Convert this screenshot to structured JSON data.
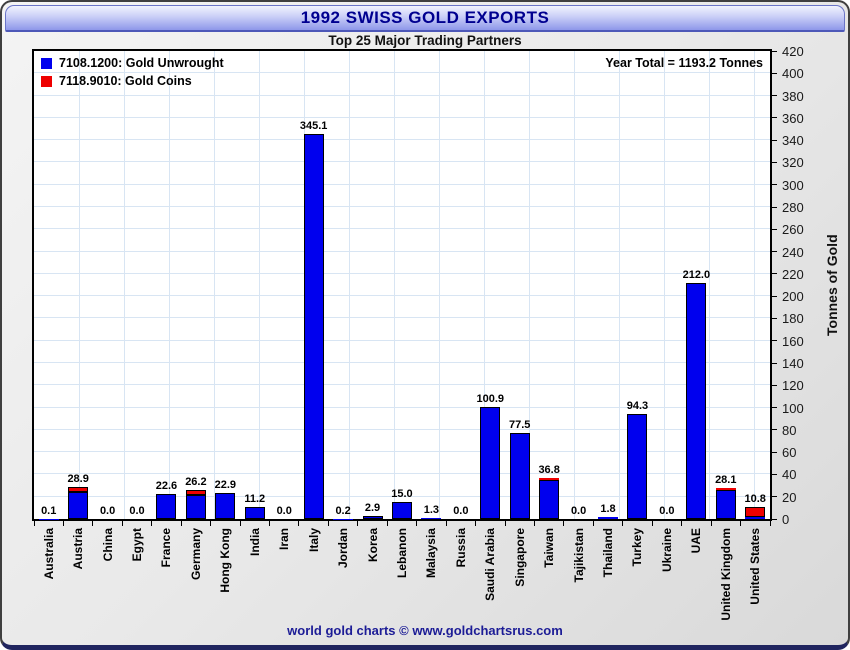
{
  "window": {
    "footer": "world gold charts © www.goldchartsrus.com"
  },
  "colors": {
    "unwrought_blue": "#0000ee",
    "coins_red": "#ee0000",
    "grid": "#d8e5f3",
    "title_navy": "#000090",
    "footer_navy": "#1c1c96"
  },
  "chart_data": {
    "type": "bar",
    "stacked": true,
    "title": "1992 SWISS GOLD EXPORTS",
    "subtitle": "Top 25 Major Trading Partners",
    "annotation": "Year Total = 1193.2 Tonnes",
    "ylabel": "Tonnes of Gold",
    "ylim": [
      0,
      420
    ],
    "ytick_step": 20,
    "grid": true,
    "legend_position": "top-left",
    "categories": [
      "Australia",
      "Austria",
      "China",
      "Egypt",
      "France",
      "Germany",
      "Hong Kong",
      "India",
      "Iran",
      "Italy",
      "Jordan",
      "Korea",
      "Lebanon",
      "Malaysia",
      "Russia",
      "Saudi Arabia",
      "Singapore",
      "Taiwan",
      "Tajikistan",
      "Thailand",
      "Turkey",
      "Ukraine",
      "UAE",
      "United Kingdom",
      "United States"
    ],
    "series": [
      {
        "name": "7108.1200: Gold Unwrought",
        "color": "#0000ee",
        "values": [
          0.1,
          24.2,
          0.0,
          0.0,
          22.6,
          22.0,
          22.9,
          11.2,
          0.0,
          345.1,
          0.2,
          2.9,
          15.0,
          1.3,
          0.0,
          100.9,
          77.5,
          35.3,
          0.0,
          1.8,
          94.3,
          0.0,
          212.0,
          25.7,
          1.5
        ]
      },
      {
        "name": "7118.9010: Gold Coins",
        "color": "#ee0000",
        "values": [
          0.0,
          4.7,
          0.0,
          0.0,
          0.0,
          4.2,
          0.0,
          0.0,
          0.0,
          0.0,
          0.0,
          0.0,
          0.0,
          0.0,
          0.0,
          0.0,
          0.0,
          1.5,
          0.0,
          0.0,
          0.0,
          0.0,
          0.0,
          2.4,
          9.3
        ]
      }
    ],
    "total_labels": [
      "0.1",
      "28.9",
      "0.0",
      "0.0",
      "22.6",
      "26.2",
      "22.9",
      "11.2",
      "0.0",
      "345.1",
      "0.2",
      "2.9",
      "15.0",
      "1.3",
      "0.0",
      "100.9",
      "77.5",
      "36.8",
      "0.0",
      "1.8",
      "94.3",
      "0.0",
      "212.0",
      "28.1",
      "10.8"
    ]
  }
}
